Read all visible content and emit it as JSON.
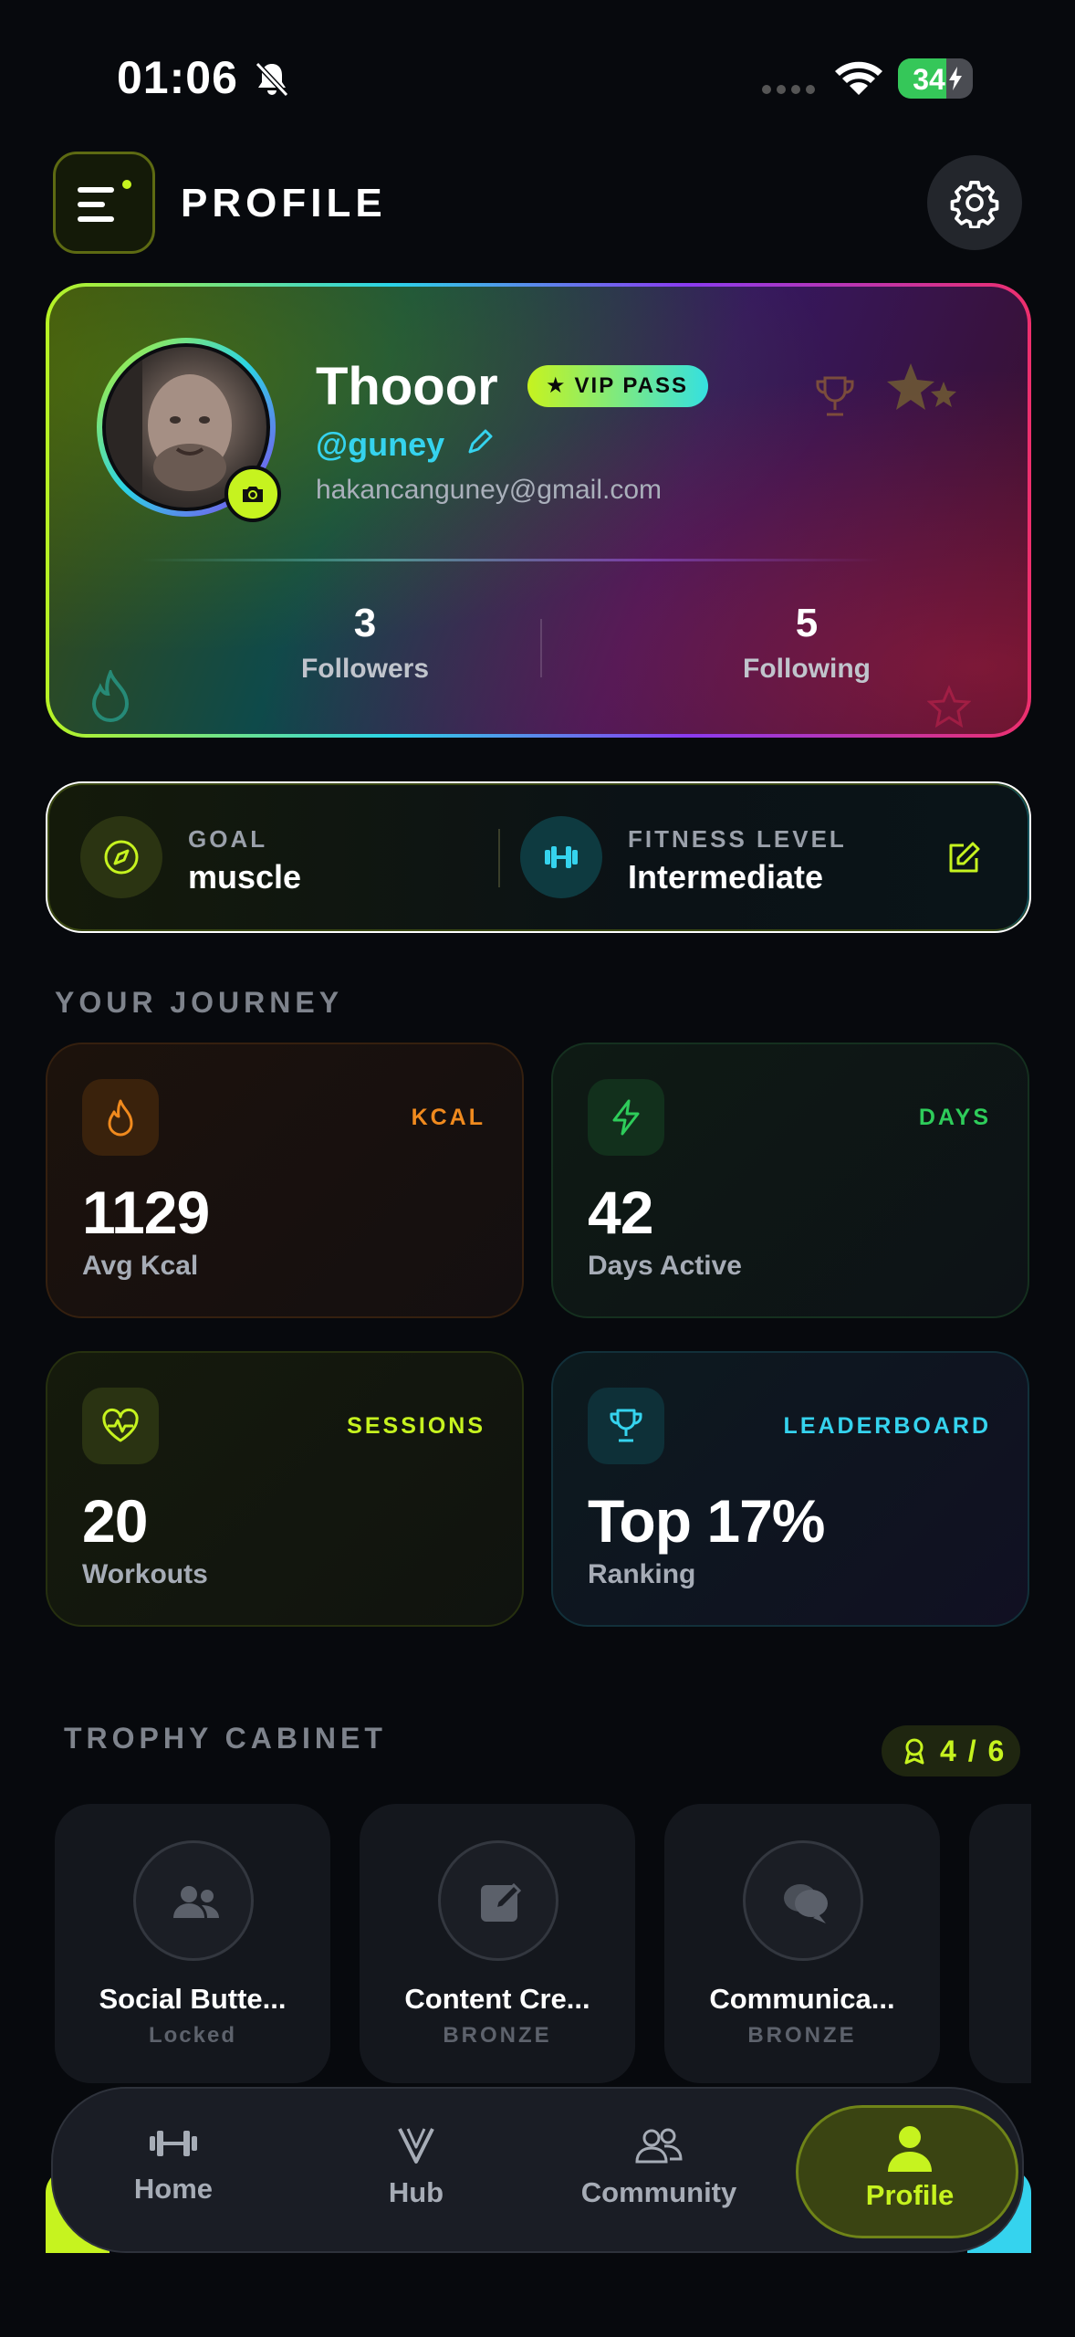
{
  "status_bar": {
    "time": "01:06",
    "battery": "34"
  },
  "header": {
    "title": "PROFILE"
  },
  "profile": {
    "name": "Thooor",
    "vip_label": "VIP PASS",
    "handle": "@guney",
    "email": "hakancanguney@gmail.com",
    "followers_count": "3",
    "followers_label": "Followers",
    "following_count": "5",
    "following_label": "Following"
  },
  "goal": {
    "goal_label": "GOAL",
    "goal_value": "muscle",
    "fitness_label": "FITNESS LEVEL",
    "fitness_value": "Intermediate"
  },
  "journey": {
    "title": "YOUR JOURNEY",
    "cards": [
      {
        "tag": "KCAL",
        "value": "1129",
        "label": "Avg Kcal",
        "color": "#f08a1e"
      },
      {
        "tag": "DAYS",
        "value": "42",
        "label": "Days Active",
        "color": "#2ecc5a"
      },
      {
        "tag": "SESSIONS",
        "value": "20",
        "label": "Workouts",
        "color": "#c6f31f"
      },
      {
        "tag": "LEADERBOARD",
        "value": "Top 17%",
        "label": "Ranking",
        "color": "#35d3ee"
      }
    ]
  },
  "trophies": {
    "title": "TROPHY CABINET",
    "count": "4 / 6",
    "items": [
      {
        "name": "Social Butte...",
        "tier": "Locked"
      },
      {
        "name": "Content Cre...",
        "tier": "BRONZE"
      },
      {
        "name": "Communica...",
        "tier": "BRONZE"
      }
    ]
  },
  "nav": {
    "home": "Home",
    "hub": "Hub",
    "community": "Community",
    "profile": "Profile"
  },
  "colors": {
    "accent": "#c6f31f",
    "cyan": "#35d3ee",
    "background": "#07090d"
  }
}
